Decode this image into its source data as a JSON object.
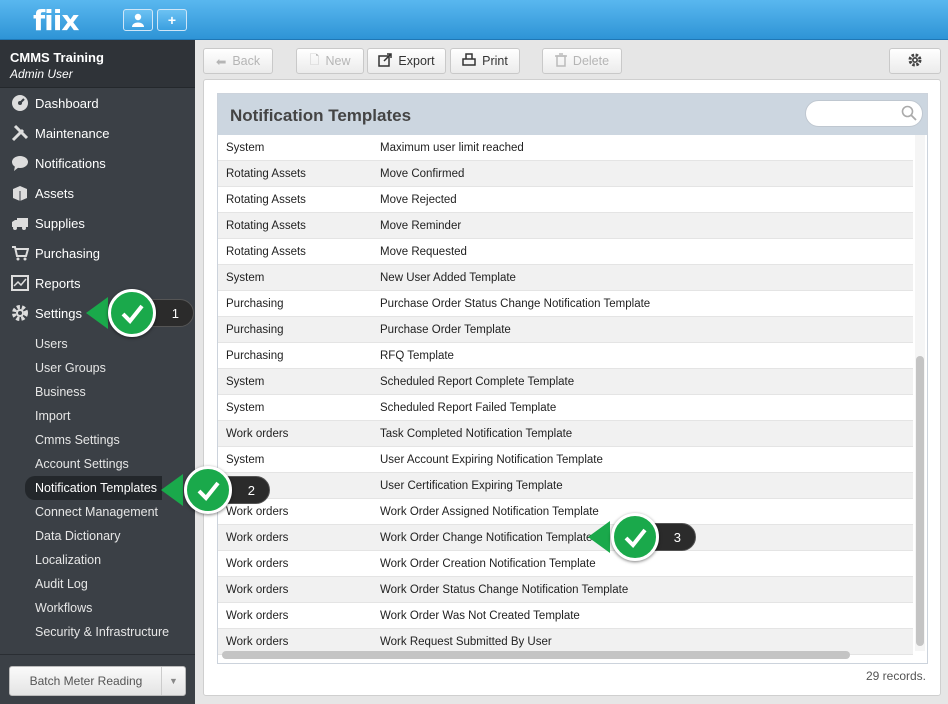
{
  "app": {
    "logo": "fiix"
  },
  "account": {
    "company": "CMMS Training",
    "user": "Admin User"
  },
  "nav": [
    {
      "label": "Dashboard",
      "icon": "dashboard-icon"
    },
    {
      "label": "Maintenance",
      "icon": "tools-icon"
    },
    {
      "label": "Notifications",
      "icon": "chat-bubble-icon"
    },
    {
      "label": "Assets",
      "icon": "box-icon"
    },
    {
      "label": "Supplies",
      "icon": "truck-icon"
    },
    {
      "label": "Purchasing",
      "icon": "cart-icon"
    },
    {
      "label": "Reports",
      "icon": "chart-icon"
    },
    {
      "label": "Settings",
      "icon": "gear-icon"
    }
  ],
  "settings_sub": [
    "Users",
    "User Groups",
    "Business",
    "Import",
    "Cmms Settings",
    "Account Settings",
    "Notification Templates",
    "Connect Management",
    "Data Dictionary",
    "Localization",
    "Audit Log",
    "Workflows",
    "Security & Infrastructure"
  ],
  "batch_button": "Batch Meter Reading",
  "toolbar": {
    "back": "Back",
    "new": "New",
    "export": "Export",
    "print": "Print",
    "delete": "Delete"
  },
  "grid": {
    "title": "Notification Templates",
    "search_placeholder": "",
    "rows": [
      [
        "System",
        "Maximum user limit reached"
      ],
      [
        "Rotating Assets",
        "Move Confirmed"
      ],
      [
        "Rotating Assets",
        "Move Rejected"
      ],
      [
        "Rotating Assets",
        "Move Reminder"
      ],
      [
        "Rotating Assets",
        "Move Requested"
      ],
      [
        "System",
        "New User Added Template"
      ],
      [
        "Purchasing",
        "Purchase Order Status Change Notification Template"
      ],
      [
        "Purchasing",
        "Purchase Order Template"
      ],
      [
        "Purchasing",
        "RFQ Template"
      ],
      [
        "System",
        "Scheduled Report Complete Template"
      ],
      [
        "System",
        "Scheduled Report Failed Template"
      ],
      [
        "Work orders",
        "Task Completed Notification Template"
      ],
      [
        "System",
        "User Account Expiring Notification Template"
      ],
      [
        "",
        "User Certification Expiring Template"
      ],
      [
        "Work orders",
        "Work Order Assigned Notification Template"
      ],
      [
        "Work orders",
        "Work Order Change Notification Template"
      ],
      [
        "Work orders",
        "Work Order Creation Notification Template"
      ],
      [
        "Work orders",
        "Work Order Status Change Notification Template"
      ],
      [
        "Work orders",
        "Work Order Was Not Created Template"
      ],
      [
        "Work orders",
        "Work Request Submitted By User"
      ]
    ],
    "records": "29 records."
  },
  "callouts": [
    "1",
    "2",
    "3"
  ],
  "colors": {
    "accent": "#2e94d6",
    "callout": "#1aa94b",
    "sidebar": "#3b4046"
  }
}
